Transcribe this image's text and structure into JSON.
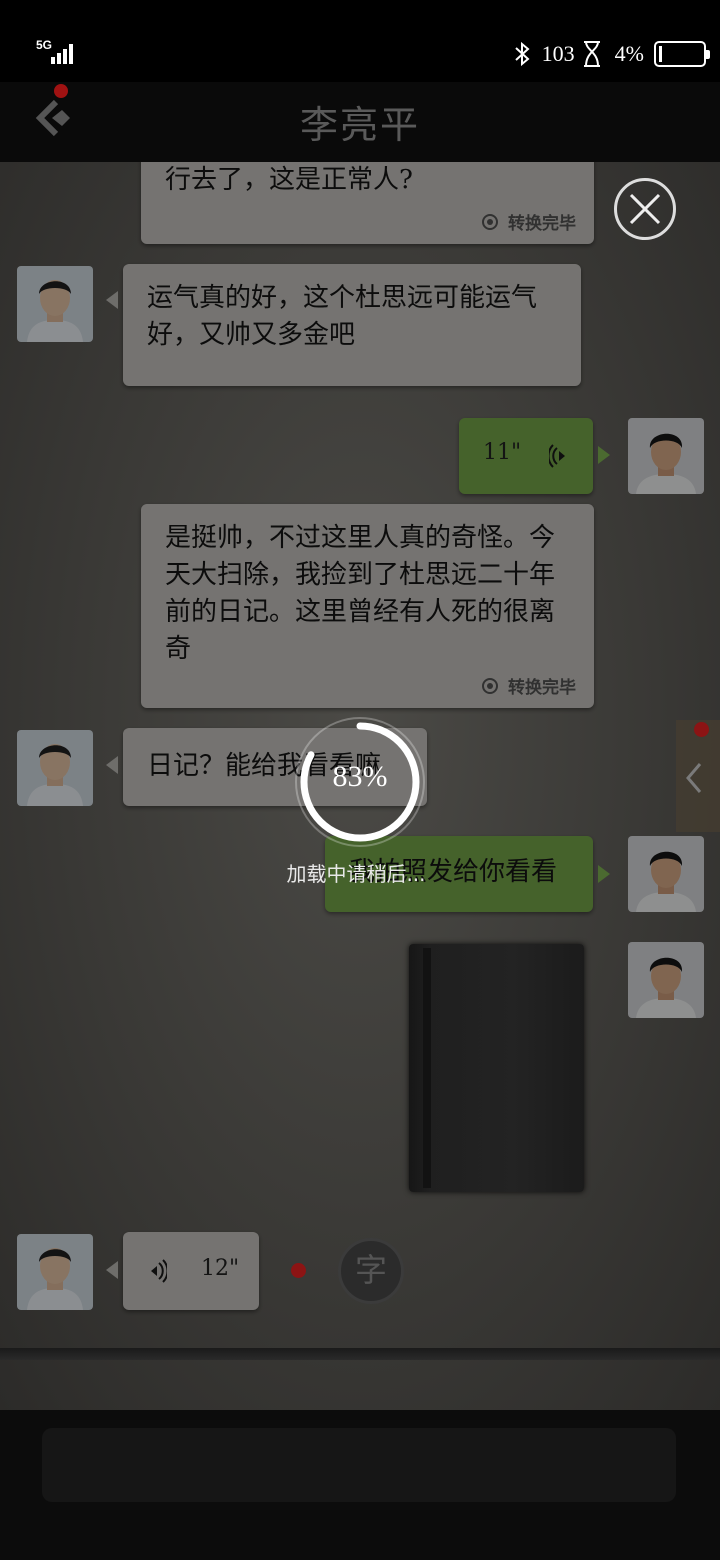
{
  "status": {
    "network": "5G",
    "data_rate": "103",
    "battery": "4%"
  },
  "header": {
    "title": "李亮平"
  },
  "messages": {
    "m1": {
      "text": "行去了，这是正常人?",
      "status": "转换完毕"
    },
    "m2": {
      "text": "运气真的好，这个杜思远可能运气好，又帅又多金吧"
    },
    "m3": {
      "duration": "11\""
    },
    "m4": {
      "text": "是挺帅，不过这里人真的奇怪。今天大扫除，我捡到了杜思远二十年前的日记。这里曾经有人死的很离奇",
      "status": "转换完毕"
    },
    "m5": {
      "text": "日记？能给我看看嘛"
    },
    "m6": {
      "text": "我拍照发给你看看"
    },
    "m8": {
      "duration": "12\""
    }
  },
  "convert_button": {
    "label": "字"
  },
  "loading": {
    "percent_text": "83%",
    "progress": 0.83,
    "text": "加载中请稍后..."
  },
  "colors": {
    "bubble_left": "#c9c7c2",
    "bubble_right": "#77a94a",
    "unread_dot": "#a01212"
  }
}
